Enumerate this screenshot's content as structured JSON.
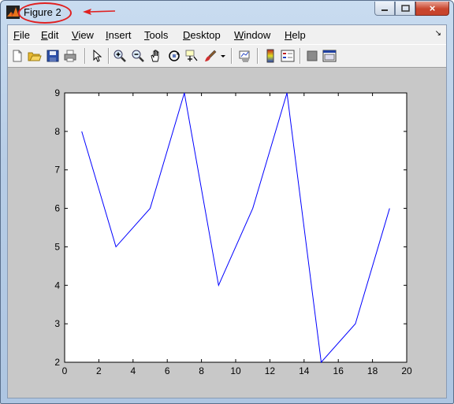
{
  "window": {
    "title": "Figure 2",
    "buttons": {
      "minimize": "minimize",
      "maximize": "maximize",
      "close": "×"
    }
  },
  "menu": [
    "File",
    "Edit",
    "View",
    "Insert",
    "Tools",
    "Desktop",
    "Window",
    "Help"
  ],
  "toolbar": [
    "new-figure-icon",
    "open-file-icon",
    "save-figure-icon",
    "print-figure-icon",
    "edit-plot-arrow-icon",
    "zoom-in-icon",
    "zoom-out-icon",
    "pan-hand-icon",
    "rotate-3d-icon",
    "data-cursor-icon",
    "brush-icon",
    "brush-dropdown-icon",
    "link-plot-icon",
    "insert-colorbar-icon",
    "insert-legend-icon",
    "hide-plot-tools-icon",
    "show-plot-tools-icon"
  ],
  "colors": {
    "line": "#0000ff",
    "annotation": "#e02020",
    "figure_bg": "#c8c8c8",
    "axes_bg": "#ffffff"
  },
  "chart_data": {
    "type": "line",
    "x": [
      1,
      3,
      5,
      7,
      9,
      11,
      13,
      15,
      17,
      19
    ],
    "y": [
      8,
      5,
      6,
      9,
      4,
      6,
      9,
      2,
      3,
      6
    ],
    "xlim": [
      0,
      20
    ],
    "ylim": [
      2,
      9
    ],
    "xticks": [
      0,
      2,
      4,
      6,
      8,
      10,
      12,
      14,
      16,
      18,
      20
    ],
    "yticks": [
      2,
      3,
      4,
      5,
      6,
      7,
      8,
      9
    ],
    "grid": false,
    "title": "",
    "xlabel": "",
    "ylabel": ""
  }
}
